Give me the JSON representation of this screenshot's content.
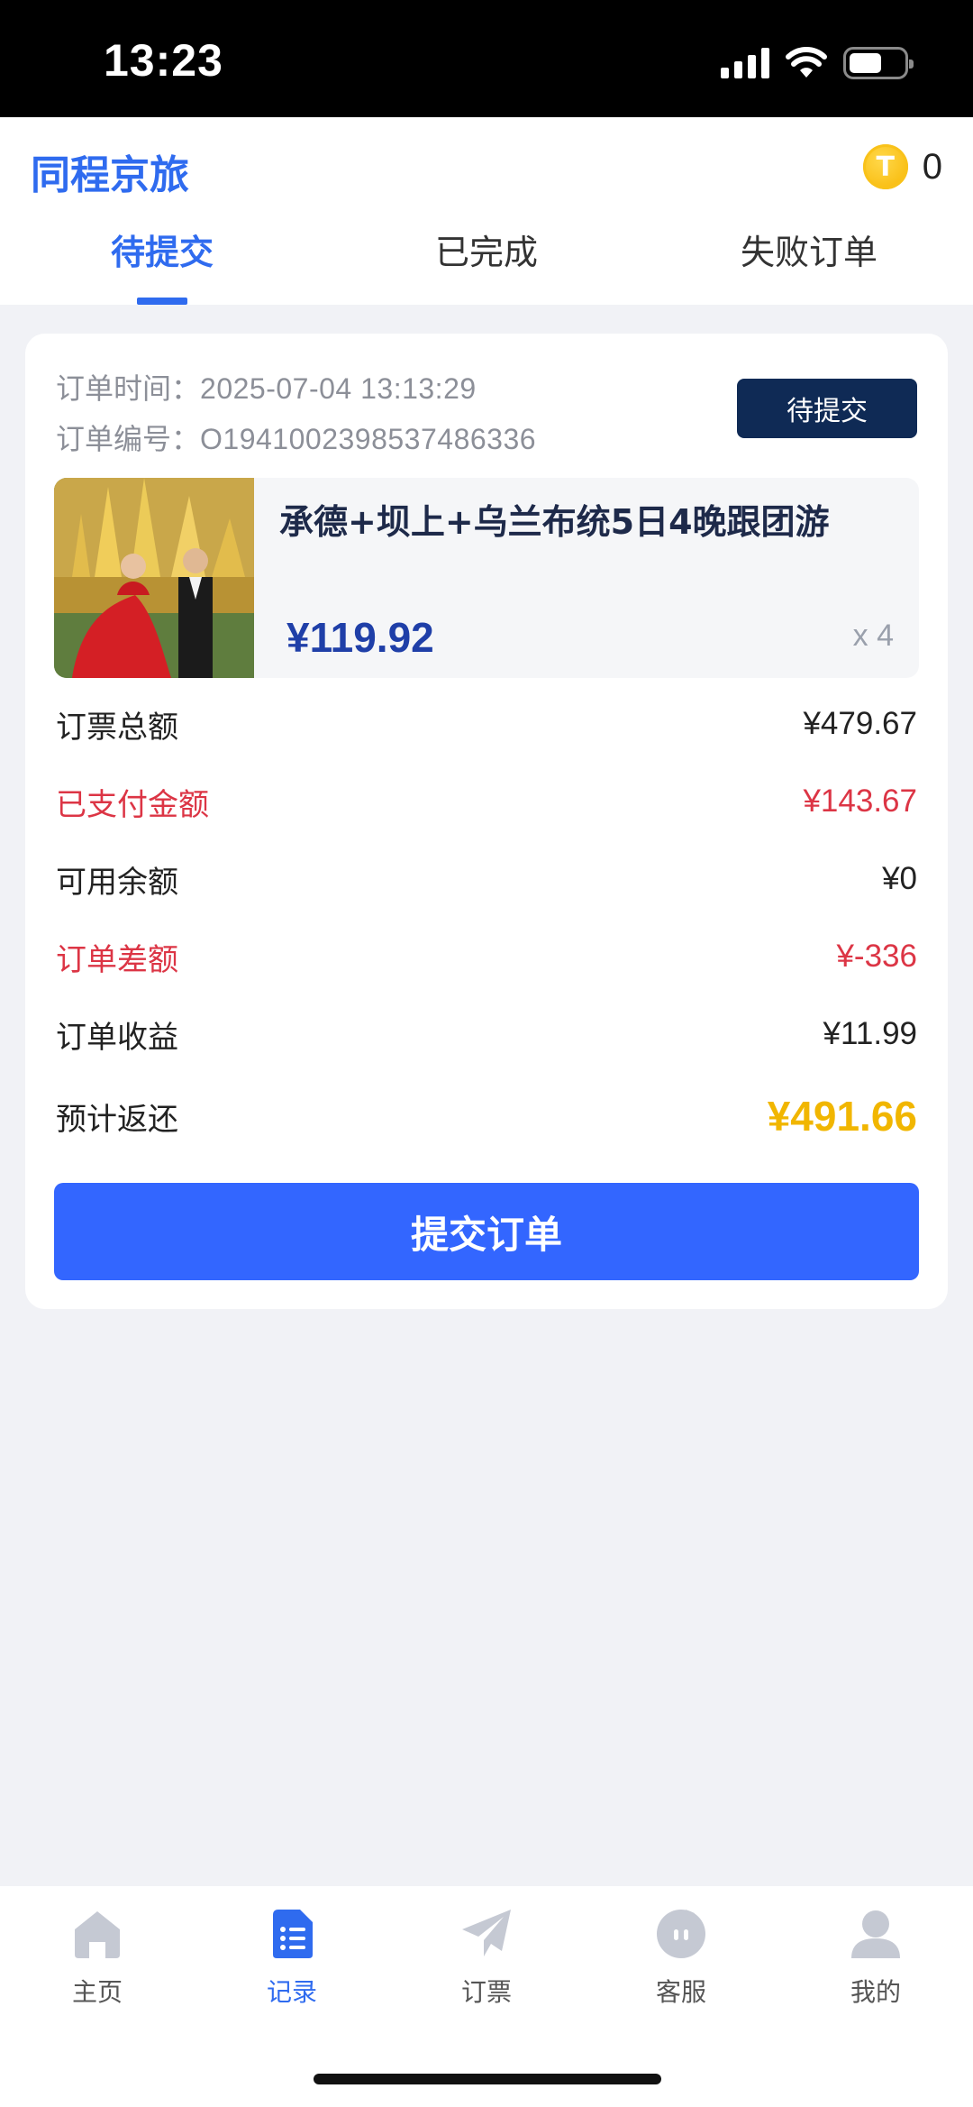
{
  "status_bar": {
    "time": "13:23",
    "battery_level": 0.6
  },
  "header": {
    "app_title": "同程京旅",
    "coin_symbol": "T",
    "coin_count": "0",
    "tabs": [
      {
        "label": "待提交",
        "active": true
      },
      {
        "label": "已完成",
        "active": false
      },
      {
        "label": "失败订单",
        "active": false
      }
    ]
  },
  "order": {
    "time_label": "订单时间：",
    "time_value": "2025-07-04 13:13:29",
    "number_label": "订单编号：",
    "number_value": "O1941002398537486336",
    "status": "待提交",
    "product_name": "承德+坝上+乌兰布统5日4晚跟团游",
    "product_price": "¥119.92",
    "product_qty": "x 4",
    "rows": [
      {
        "label": "订票总额",
        "value": "¥479.67"
      },
      {
        "label": "已支付金额",
        "value": "¥143.67"
      },
      {
        "label": "可用余额",
        "value": "¥0"
      },
      {
        "label": "订单差额",
        "value": "¥-336"
      },
      {
        "label": "订单收益",
        "value": "¥11.99"
      },
      {
        "label": "预计返还",
        "value": "¥491.66"
      }
    ],
    "submit_label": "提交订单"
  },
  "bottom_nav": [
    {
      "label": "主页",
      "icon": "home-icon",
      "active": false
    },
    {
      "label": "记录",
      "icon": "records-icon",
      "active": true
    },
    {
      "label": "订票",
      "icon": "paper-plane-icon",
      "active": false
    },
    {
      "label": "客服",
      "icon": "chat-icon",
      "active": false
    },
    {
      "label": "我的",
      "icon": "user-icon",
      "active": false
    }
  ],
  "colors": {
    "brand_blue": "#2f6bef",
    "button_blue": "#3366ff",
    "badge_navy": "#0f2a55",
    "alert_red": "#dc3545",
    "refund_gold": "#f1b600"
  }
}
